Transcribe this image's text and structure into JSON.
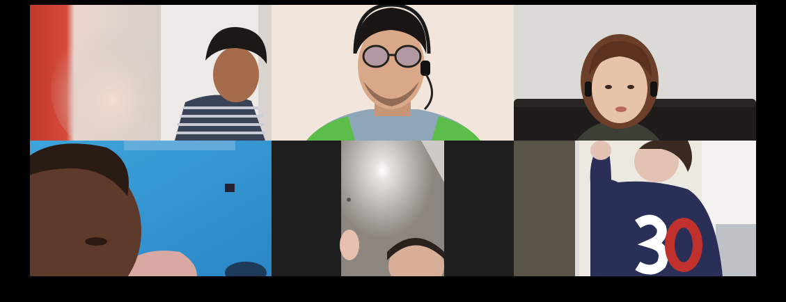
{
  "app": {
    "window_title": ""
  },
  "gallery": {
    "layout": "grid",
    "tiles": [
      {
        "name": "",
        "icon": "video-feed-icon"
      },
      {
        "name": "",
        "icon": "video-feed-icon"
      },
      {
        "name": "",
        "icon": "video-feed-icon"
      },
      {
        "name": "",
        "icon": "video-feed-icon"
      },
      {
        "name": "",
        "icon": "video-feed-icon"
      },
      {
        "name": "",
        "icon": "video-feed-icon"
      },
      {
        "name": "",
        "icon": "video-feed-icon"
      }
    ]
  },
  "colors": {
    "background": "#000000",
    "letterbox": "#1e1e1e"
  }
}
